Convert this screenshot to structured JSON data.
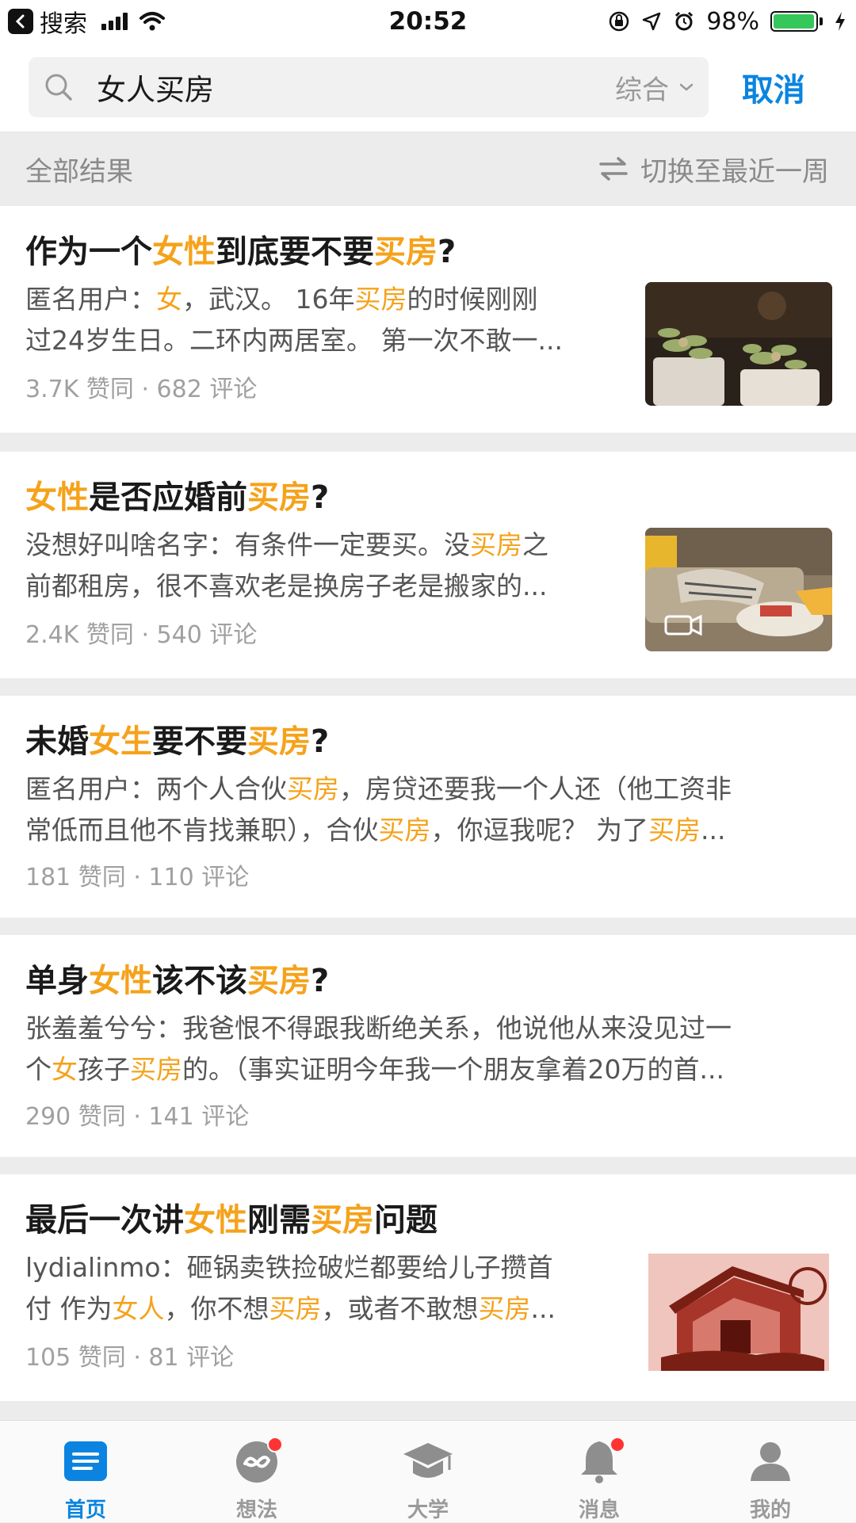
{
  "status_bar": {
    "back_label": "搜索",
    "time": "20:52",
    "battery": "98%",
    "battery_level": 0.98
  },
  "search": {
    "query": "女人买房",
    "sort_label": "综合",
    "cancel_label": "取消"
  },
  "results_header": {
    "title": "全部结果",
    "switch_label": "切换至最近一周"
  },
  "highlight_color": "#f5a21b",
  "accent_color": "#0a84e0",
  "results": [
    {
      "title": [
        {
          "t": "作为一个"
        },
        {
          "t": "女性",
          "h": true
        },
        {
          "t": "到底要不要"
        },
        {
          "t": "买房",
          "h": true
        },
        {
          "t": "?"
        }
      ],
      "excerpt_lines": [
        [
          {
            "t": "匿名用户："
          },
          {
            "t": "女",
            "h": true
          },
          {
            "t": "，武汉。 16年"
          },
          {
            "t": "买房",
            "h": true
          },
          {
            "t": "的时候刚刚"
          }
        ],
        [
          {
            "t": "过24岁生日。二环内两居室。 第一次不敢一..."
          }
        ]
      ],
      "meta": "3.7K 赞同 · 682 评论",
      "thumb": "succulent-plants-image"
    },
    {
      "title": [
        {
          "t": "女性",
          "h": true
        },
        {
          "t": "是否应婚前"
        },
        {
          "t": "买房",
          "h": true
        },
        {
          "t": "?"
        }
      ],
      "excerpt_lines": [
        [
          {
            "t": "没想好叫啥名字：有条件一定要买。没"
          },
          {
            "t": "买房",
            "h": true
          },
          {
            "t": "之"
          }
        ],
        [
          {
            "t": "前都租房，很不喜欢老是换房子老是搬家的..."
          }
        ]
      ],
      "meta": "2.4K 赞同 · 540 评论",
      "thumb": "living-room-video-thumbnail"
    },
    {
      "title": [
        {
          "t": "未婚"
        },
        {
          "t": "女生",
          "h": true
        },
        {
          "t": "要不要"
        },
        {
          "t": "买房",
          "h": true
        },
        {
          "t": "?"
        }
      ],
      "excerpt_lines": [
        [
          {
            "t": "匿名用户：两个人合伙"
          },
          {
            "t": "买房",
            "h": true
          },
          {
            "t": "，房贷还要我一个人还（他工资非"
          }
        ],
        [
          {
            "t": "常低而且他不肯找兼职），合伙"
          },
          {
            "t": "买房",
            "h": true
          },
          {
            "t": "，你逗我呢？ 为了"
          },
          {
            "t": "买房",
            "h": true
          },
          {
            "t": "..."
          }
        ]
      ],
      "meta": "181 赞同 · 110 评论"
    },
    {
      "title": [
        {
          "t": "单身"
        },
        {
          "t": "女性",
          "h": true
        },
        {
          "t": "该不该"
        },
        {
          "t": "买房",
          "h": true
        },
        {
          "t": "?"
        }
      ],
      "excerpt_lines": [
        [
          {
            "t": "张羞羞兮兮：我爸恨不得跟我断绝关系，他说他从来没见过一"
          }
        ],
        [
          {
            "t": "个"
          },
          {
            "t": "女",
            "h": true
          },
          {
            "t": "孩子"
          },
          {
            "t": "买房",
            "h": true
          },
          {
            "t": "的。（事实证明今年我一个朋友拿着20万的首..."
          }
        ]
      ],
      "meta": "290 赞同 · 141 评论"
    },
    {
      "title": [
        {
          "t": "最后一次讲"
        },
        {
          "t": "女性",
          "h": true
        },
        {
          "t": "刚需"
        },
        {
          "t": "买房",
          "h": true
        },
        {
          "t": "问题"
        }
      ],
      "excerpt_lines": [
        [
          {
            "t": "lydialinmo：砸锅卖铁捡破烂都要给儿子攒首"
          }
        ],
        [
          {
            "t": "付 作为"
          },
          {
            "t": "女人",
            "h": true
          },
          {
            "t": "，你不想"
          },
          {
            "t": "买房",
            "h": true
          },
          {
            "t": "，或者不敢想"
          },
          {
            "t": "买房",
            "h": true
          },
          {
            "t": "..."
          }
        ]
      ],
      "meta": "105 赞同 · 81 评论",
      "thumb": "house-clipart-image"
    }
  ],
  "tabbar": [
    {
      "label": "首页",
      "icon": "home-feed-icon",
      "active": true
    },
    {
      "label": "想法",
      "icon": "ideas-icon",
      "badge": true
    },
    {
      "label": "大学",
      "icon": "graduation-cap-icon"
    },
    {
      "label": "消息",
      "icon": "bell-icon",
      "badge": true
    },
    {
      "label": "我的",
      "icon": "profile-icon"
    }
  ]
}
